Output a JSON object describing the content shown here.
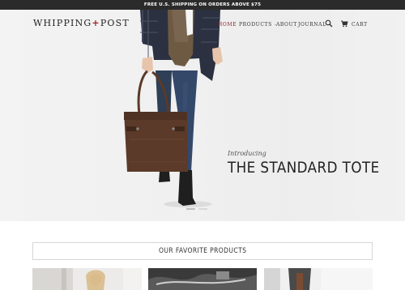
{
  "announcement": "FREE U.S. SHIPPING ON ORDERS ABOVE $75",
  "brand": {
    "name_left": "WHIPPING",
    "plus": "+",
    "name_right": "POST",
    "accent_color": "#9b2226"
  },
  "nav": {
    "items": [
      {
        "label": "HOME",
        "active": true
      },
      {
        "label": "PRODUCTS",
        "dropdown": true
      },
      {
        "label": "ABOUT"
      },
      {
        "label": "JOURNAL"
      }
    ],
    "search_icon": "search-icon",
    "cart_label": "CART",
    "cart_icon": "cart-icon"
  },
  "hero": {
    "intro": "Introducing",
    "headline": "THE STANDARD TOTE",
    "slides": 2,
    "active_slide": 0
  },
  "featured": {
    "title": "OUR FAVORITE PRODUCTS"
  },
  "colors": {
    "announcement_bg": "#2b2b2b",
    "nav_active": "#8b1e22",
    "tote_leather": "#5b3a29"
  }
}
